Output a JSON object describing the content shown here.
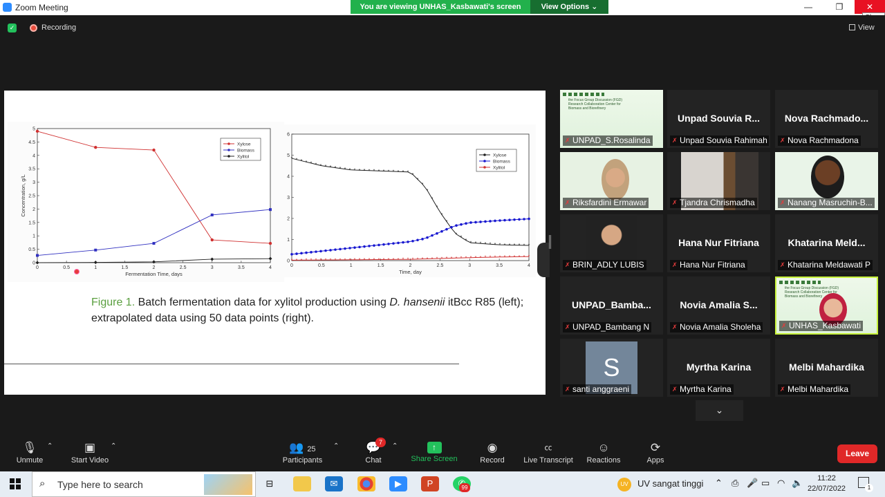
{
  "window": {
    "title": "Zoom Meeting",
    "banner": "You are viewing UNHAS_Kasbawati's screen",
    "view_options": "View Options",
    "close_tip": "Close"
  },
  "meeting": {
    "recording_label": "Recording",
    "view_label": "View"
  },
  "slide": {
    "caption_prefix": "Figure 1.",
    "caption_text": " Batch fermentation data for xylitol production using ",
    "caption_species": "D. hansenii",
    "caption_text2": " itBcc R85 (left); extrapolated data using 50 data points (right)."
  },
  "chart_data": [
    {
      "type": "line",
      "xlabel": "Fermentation Time, days",
      "ylabel": "Concentration, g/L",
      "xlim": [
        0,
        4
      ],
      "ylim": [
        0,
        5
      ],
      "x_ticks": [
        "0",
        "0.5",
        "1",
        "1.5",
        "2",
        "2.5",
        "3",
        "3.5",
        "4"
      ],
      "y_ticks": [
        "0",
        "0.5",
        "1",
        "1.5",
        "2",
        "2.5",
        "3",
        "3.5",
        "4",
        "4.5",
        "5"
      ],
      "legend_position": "top-right",
      "series": [
        {
          "name": "Xylose",
          "color": "#d03030",
          "marker": "circle",
          "x": [
            0,
            1,
            2,
            3,
            4
          ],
          "y": [
            4.9,
            4.3,
            4.2,
            0.85,
            0.72
          ]
        },
        {
          "name": "Biomass",
          "color": "#3030c0",
          "marker": "square",
          "x": [
            0,
            1,
            2,
            3,
            4
          ],
          "y": [
            0.27,
            0.47,
            0.72,
            1.78,
            1.98
          ]
        },
        {
          "name": "Xylitol",
          "color": "#202020",
          "marker": "diamond",
          "x": [
            0,
            1,
            2,
            3,
            4
          ],
          "y": [
            0.0,
            0.01,
            0.03,
            0.13,
            0.15
          ]
        }
      ]
    },
    {
      "type": "line",
      "xlabel": "Time, day",
      "ylabel": "Concentration, g/L",
      "xlim": [
        0,
        4
      ],
      "ylim": [
        0,
        6
      ],
      "x_ticks": [
        "0",
        "0.5",
        "1",
        "1.5",
        "2",
        "2.5",
        "3",
        "3.5",
        "4"
      ],
      "y_ticks": [
        "0",
        "1",
        "2",
        "3",
        "4",
        "5",
        "6"
      ],
      "legend_position": "top-right",
      "series": [
        {
          "name": "Xylose",
          "color": "#202020",
          "marker": "star",
          "x": [
            0,
            0.5,
            1,
            1.5,
            2,
            2.25,
            2.5,
            2.75,
            3,
            3.5,
            4
          ],
          "y": [
            4.85,
            4.5,
            4.3,
            4.25,
            4.2,
            3.5,
            2.3,
            1.3,
            0.85,
            0.75,
            0.72
          ]
        },
        {
          "name": "Biomass",
          "color": "#1818d0",
          "marker": "circle",
          "x": [
            0,
            0.5,
            1,
            1.5,
            2,
            2.25,
            2.5,
            2.75,
            3,
            3.5,
            4
          ],
          "y": [
            0.3,
            0.45,
            0.6,
            0.75,
            0.9,
            1.05,
            1.35,
            1.65,
            1.8,
            1.9,
            1.98
          ]
        },
        {
          "name": "Xylitol",
          "color": "#d03030",
          "marker": "star",
          "x": [
            0,
            0.5,
            1,
            1.5,
            2,
            2.5,
            3,
            3.5,
            4
          ],
          "y": [
            0.02,
            0.03,
            0.04,
            0.05,
            0.06,
            0.1,
            0.14,
            0.17,
            0.19
          ]
        }
      ]
    }
  ],
  "participants": [
    {
      "label": "UNPAD_S.Rosalinda",
      "kind": "slide"
    },
    {
      "big": "Unpad Souvia R...",
      "label": "Unpad Souvia Rahimah"
    },
    {
      "big": "Nova  Rachmado...",
      "label": "Nova Rachmadona"
    },
    {
      "label": "Riksfardini Ermawar",
      "kind": "video-hijab"
    },
    {
      "label": "Tjandra Chrismadha",
      "kind": "video-room"
    },
    {
      "label": "Nanang Masruchin-B...",
      "kind": "video-man"
    },
    {
      "label": "BRIN_ADLY LUBIS",
      "kind": "photo"
    },
    {
      "big": "Hana Nur Fitriana",
      "label": "Hana Nur Fitriana"
    },
    {
      "big": "Khatarina  Meld...",
      "label": "Khatarina Meldawati P"
    },
    {
      "big": "UNPAD_Bamba...",
      "label": "UNPAD_Bambang N"
    },
    {
      "big": "Novia Amalia S...",
      "label": "Novia Amalia Sholeha"
    },
    {
      "label": "UNHAS_Kasbawati",
      "kind": "active"
    },
    {
      "label": "santi anggraeni",
      "kind": "avatar",
      "avatar": "S"
    },
    {
      "big": "Myrtha Karina",
      "label": "Myrtha Karina"
    },
    {
      "big": "Melbi Mahardika",
      "label": "Melbi Mahardika"
    }
  ],
  "slide_thumb_text": "the Focus Group Discussion (FGD) Research Collaboration Center for Biomass and Biorefinery",
  "toolbar": {
    "unmute": "Unmute",
    "start_video": "Start Video",
    "participants": "Participants",
    "participants_count": "25",
    "chat": "Chat",
    "chat_badge": "7",
    "share": "Share Screen",
    "record": "Record",
    "transcript": "Live Transcript",
    "reactions": "Reactions",
    "apps": "Apps",
    "leave": "Leave"
  },
  "taskbar": {
    "search_placeholder": "Type here to search",
    "weather": "UV sangat tinggi",
    "time": "11:22",
    "date": "22/07/2022",
    "whatsapp_badge": "99",
    "notif_count": "1"
  },
  "colors": {
    "accent": "#2d8cff",
    "share_green": "#23c15c",
    "leave_red": "#e02828"
  }
}
